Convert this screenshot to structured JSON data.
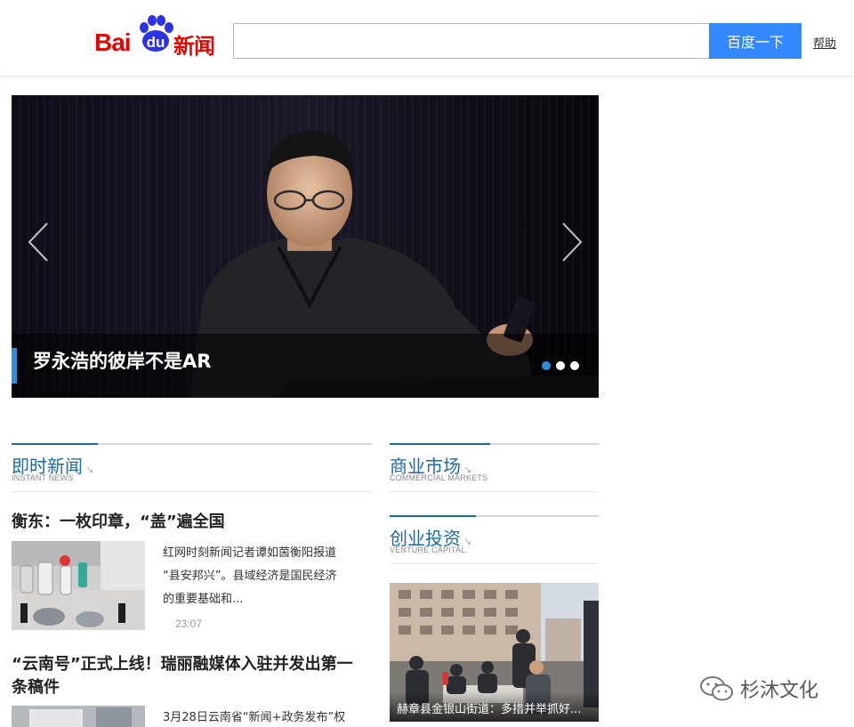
{
  "header": {
    "logo_bai": "Bai",
    "logo_du": "du",
    "logo_news": "新闻",
    "search_placeholder": "",
    "search_button": "百度一下",
    "help_link": "帮助"
  },
  "carousel": {
    "caption": "罗永浩的彼岸不是AR",
    "slide_count": 3,
    "active_slide": 1
  },
  "sections": {
    "instant": {
      "title": "即时新闻",
      "subtitle": "INSTANT NEWS"
    },
    "commercial": {
      "title": "商业市场",
      "subtitle": "COMMERCIAL MARKETS"
    },
    "venture": {
      "title": "创业投资",
      "subtitle": "VENTURE CAPITAL"
    }
  },
  "news": [
    {
      "title": "衡东：一枚印章，“盖”遍全国",
      "summary_lines": [
        "红网时刻新闻记者谭如茵衡阳报道",
        "“县安邦兴”。县域经济是国民经济",
        "的重要基础和..."
      ],
      "time": "23:07"
    },
    {
      "title_lines": [
        "“云南号”正式上线！瑞丽融媒体入驻并发出第一",
        "条稿件"
      ],
      "summary_lines": [
        "3月28日云南省“新闻+政务发布”权"
      ]
    }
  ],
  "venture_feature": {
    "caption": "赫章县金银山街道：多措并举抓好..."
  },
  "watermark": {
    "text": "杉沐文化"
  },
  "colors": {
    "brand_red": "#e10602",
    "brand_blue": "#2d32e6",
    "search_button": "#3388ff",
    "section_blue": "#1b6aa8",
    "carousel_accent": "#2b8fd6"
  }
}
